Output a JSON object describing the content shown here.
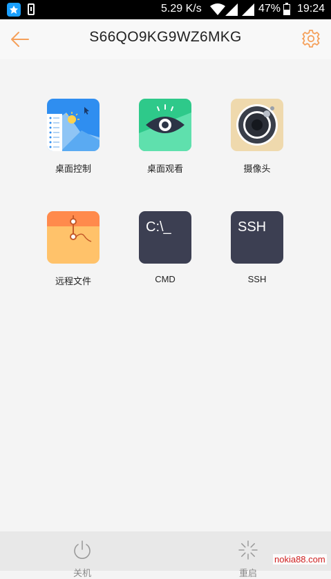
{
  "status_bar": {
    "net_speed": "5.29 K/s",
    "battery_pct": "47%",
    "battery_level": 0.47,
    "time": "19:24",
    "icons": [
      "app-notification-icon",
      "phone-notification-icon",
      "wifi-icon",
      "signal-icon",
      "signal-icon",
      "battery-icon"
    ]
  },
  "header": {
    "title": "S66QO9KG9WZ6MKG",
    "accent_color": "#f5a05a",
    "back_icon": "arrow-left-icon",
    "settings_icon": "gear-icon"
  },
  "tiles": [
    {
      "label": "桌面控制",
      "icon": "desktop-control-icon"
    },
    {
      "label": "桌面观看",
      "icon": "eye-icon"
    },
    {
      "label": "摄像头",
      "icon": "camera-icon"
    },
    {
      "label": "远程文件",
      "icon": "folder-icon"
    },
    {
      "label": "CMD",
      "icon": "cmd-terminal-icon",
      "icon_text": "C:\\_"
    },
    {
      "label": "SSH",
      "icon": "ssh-terminal-icon",
      "icon_text": "SSH"
    }
  ],
  "bottom_nav": {
    "shutdown_label": "关机",
    "shutdown_icon": "power-icon",
    "restart_label": "重启",
    "restart_icon": "loading-icon"
  },
  "watermark": "nokia88.com"
}
